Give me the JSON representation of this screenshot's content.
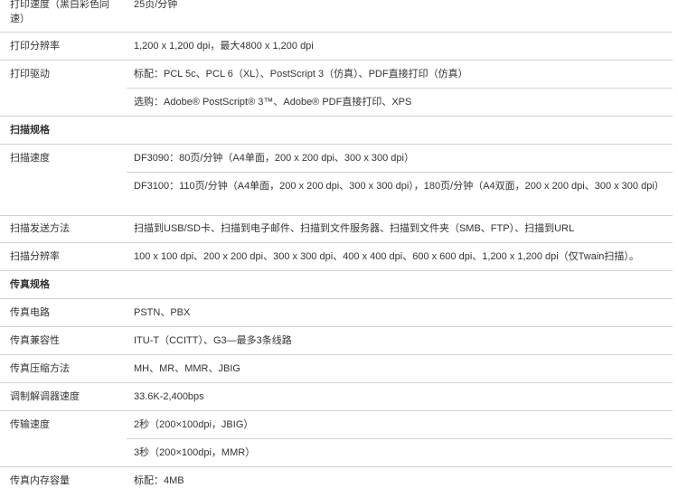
{
  "rows": [
    {
      "kind": "item",
      "label": "打印速度（黑白彩色同速）",
      "value": "25页/分钟"
    },
    {
      "kind": "item",
      "label": "打印分辨率",
      "value": "1,200 x 1,200 dpi，最大4800 x 1,200 dpi"
    },
    {
      "kind": "item",
      "label": "打印驱动",
      "value": "标配：PCL 5c、PCL 6（XL）、PostScript 3（仿真）、PDF直接打印（仿真）"
    },
    {
      "kind": "sub",
      "label": "",
      "value": "选购：Adobe® PostScript® 3™、Adobe® PDF直接打印、XPS"
    },
    {
      "kind": "section",
      "label": "扫描规格",
      "value": ""
    },
    {
      "kind": "item",
      "label": "扫描速度",
      "value": "DF3090：80页/分钟（A4单面，200 x 200 dpi、300 x 300 dpi）"
    },
    {
      "kind": "sub",
      "label": "",
      "value": "DF3100：110页/分钟（A4单面，200 x 200 dpi、300 x 300 dpi），180页/分钟（A4双面，200 x 200 dpi、300 x 300 dpi）"
    },
    {
      "kind": "item",
      "label": "扫描发送方法",
      "value": "扫描到USB/SD卡、扫描到电子邮件、扫描到文件服务器、扫描到文件夹（SMB、FTP）、扫描到URL"
    },
    {
      "kind": "item",
      "label": "扫描分辨率",
      "value": "100 x 100 dpi、200 x 200 dpi、300 x 300 dpi、400 x 400 dpi、600 x 600 dpi、1,200 x 1,200 dpi（仅Twain扫描）。"
    },
    {
      "kind": "section",
      "label": "传真规格",
      "value": ""
    },
    {
      "kind": "item",
      "label": "传真电路",
      "value": "PSTN、PBX"
    },
    {
      "kind": "item",
      "label": "传真兼容性",
      "value": "ITU-T（CCITT）、G3—最多3条线路"
    },
    {
      "kind": "item",
      "label": "传真压缩方法",
      "value": "MH、MR、MMR、JBIG"
    },
    {
      "kind": "item",
      "label": "调制解调器速度",
      "value": "33.6K-2,400bps"
    },
    {
      "kind": "item",
      "label": "传输速度",
      "value": "2秒（200×100dpi，JBIG）"
    },
    {
      "kind": "sub",
      "label": "",
      "value": "3秒（200×100dpi，MMR）"
    },
    {
      "kind": "item",
      "label": "传真内存容量",
      "value": "标配：4MB"
    }
  ]
}
